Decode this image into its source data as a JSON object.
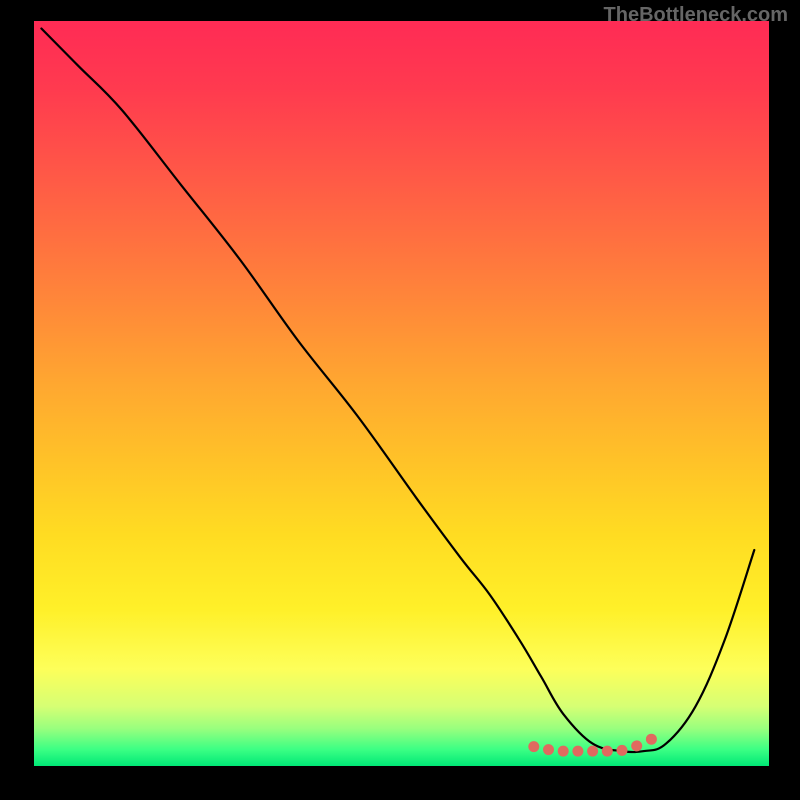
{
  "watermark": "TheBottleneck.com",
  "chart_data": {
    "type": "line",
    "title": "",
    "xlabel": "",
    "ylabel": "",
    "xlim": [
      0,
      100
    ],
    "ylim": [
      0,
      100
    ],
    "series": [
      {
        "name": "bottleneck-curve",
        "x": [
          1,
          6,
          12,
          20,
          28,
          36,
          44,
          52,
          58,
          62,
          66,
          69,
          72,
          76,
          80,
          83,
          86,
          90,
          94,
          98
        ],
        "y": [
          99,
          94,
          88,
          78,
          68,
          57,
          47,
          36,
          28,
          23,
          17,
          12,
          7,
          3,
          2,
          2,
          3,
          8,
          17,
          29
        ]
      }
    ],
    "markers": {
      "name": "valley-dots",
      "x": [
        68,
        70,
        72,
        74,
        76,
        78,
        80,
        82,
        84
      ],
      "y": [
        2.6,
        2.2,
        2.0,
        2.0,
        2.0,
        2.0,
        2.1,
        2.7,
        3.6
      ]
    }
  }
}
